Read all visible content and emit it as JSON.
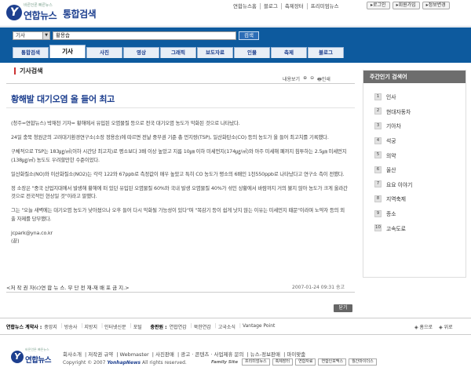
{
  "header": {
    "logo_slogan": "바른언론 빠른뉴스",
    "logo_mark": "Y",
    "logo_name": "연합뉴스",
    "service_title": "통합검색",
    "top_links": [
      "연합뉴스홈",
      "블로그",
      "축제장터",
      "프리미엄뉴스"
    ],
    "top_buttons": [
      "▸로그인",
      "▸회원가입",
      "▸정보변경"
    ]
  },
  "search": {
    "scope": "기사",
    "query": "황용습",
    "button": "검색"
  },
  "tabs": [
    "통합검색",
    "기사",
    "사진",
    "영상",
    "그래픽",
    "보도자료",
    "인물",
    "축제",
    "블로그"
  ],
  "active_tab": 1,
  "article": {
    "section_title": "기사검색",
    "tool_size": "내용보기",
    "tool_size_plus": "⊕",
    "tool_size_minus": "⊖",
    "tool_print": "인쇄",
    "headline": "황해발 대기오염 올 들어 최고",
    "paragraphs": [
      "(청주=연합뉴스) 박재천 기자= 황해에서 유입된 오염물질 등으로 전국 대기오염 농도가 악화된 것으로 나타났다.",
      "24일 충북 청원군의 고려대기환경연구소(소장 정용승)에 따르면 전날 중부권 기준 총 먼지량(TSP), 일산화탄소(CO) 등의 농도가 올 들어 최고치를 기록했다.",
      "구체적으로 TSP는 183㎍/㎥(이하 시간당 최고치)로 평소보다 3배 이상 높았고 지름 10㎛ 이하 미세먼지(174㎍/㎥)와 아주 미세해 폐까지 침투하는 2.5㎛ 미세먼지(138㎍/㎥) 농도도 우려할만한 수준이었다.",
      "일산화질소(NO)와 이산화질소(NO2)는 각각 122와 67ppb로 측정값이 매우 높았고 특히 CO 농도가 평소의 6배인 1천550ppb로 나타났다고 연구소 측이 전했다.",
      "정 소장은 \"중국 산업지대에서 발생해 황해에 떠 있던 유입된 오염물질 60%와 국내 발생 오염물질 40%가 섞인 상황에서 바람까지 거의 불지 않아 농도가 크게 올라간 것으로 전국적인 현상일 것\"이라고 말했다.",
      "그는 \"오늘 새벽에는 대기오염 농도가 낮아졌으나 오후 들어 다시 악화될 가능성이 있다\"며 \"목감기 등이 쉽게 낫지 않는 이유는 미세먼지 때문\"이라며 노약자 등의 외출 자제를 당부했다."
    ],
    "email": "jcpark@yna.co.kr",
    "end_mark": "(끝)",
    "copyright": "<저 작 권 자(c)연 합 뉴 스. 무 단 전 재-재 배 포 금 지.>",
    "date": "2007-01-24 09:31 송고",
    "close_button": "닫기"
  },
  "sidebar": {
    "title": "주간인기 검색어",
    "items": [
      "인사",
      "현대자동차",
      "기아차",
      "석궁",
      "의약",
      "울산",
      "요요 이야기",
      "지역축제",
      "종소",
      "고속도로"
    ]
  },
  "footer": {
    "family_label": "연합뉴스 계약사 :",
    "family_items": [
      "중앙지",
      "방송사",
      "지방지",
      "인터넷신문",
      "포털"
    ],
    "member_label": "충판원 :",
    "member_items": [
      "연합연감",
      "북한연감",
      "고국소식",
      "Vantage Point"
    ],
    "nav_top": "◈ 흠으로",
    "nav_up": "◈ 위로",
    "links": [
      "회사소개",
      "저작권 규약",
      "Webmaster",
      "사진판매",
      "광고 · 콘텐츠 · 사업제휴 문의",
      "뉴스-정보판매",
      "마이맞춤"
    ],
    "copyright_prefix": "Copyright © 2007",
    "copyright_brand": "YonhapNews",
    "copyright_suffix": "All rights reserved.",
    "family_site_label": "Family Site",
    "family_sites": [
      "프리미엄뉴스",
      "축제장터",
      "연합자료",
      "연합인포맥스",
      "월간마이더스"
    ]
  }
}
